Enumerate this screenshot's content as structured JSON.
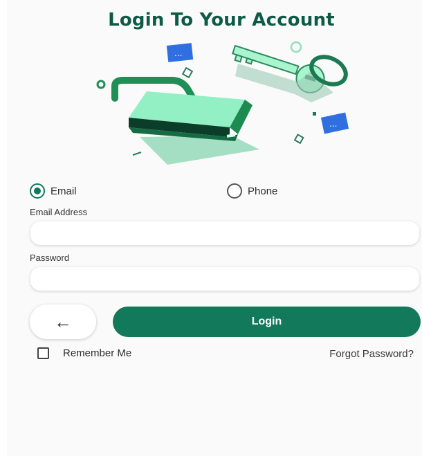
{
  "title": "Login To Your Account",
  "login_method": {
    "options": [
      {
        "label": "Email",
        "selected": true
      },
      {
        "label": "Phone",
        "selected": false
      }
    ]
  },
  "form": {
    "email_label": "Email Address",
    "email_value": "",
    "password_label": "Password",
    "password_value": ""
  },
  "actions": {
    "back_icon": "←",
    "login_label": "Login",
    "remember_label": "Remember Me",
    "remember_checked": false,
    "forgot_label": "Forgot Password?"
  },
  "colors": {
    "brand": "#12795b",
    "title": "#0d5a45",
    "illustration_green": "#8be8bd",
    "illustration_blue": "#2f6fe0"
  },
  "icons": {
    "illustration": "padlock-key-illustration",
    "back": "arrow-left-icon"
  }
}
